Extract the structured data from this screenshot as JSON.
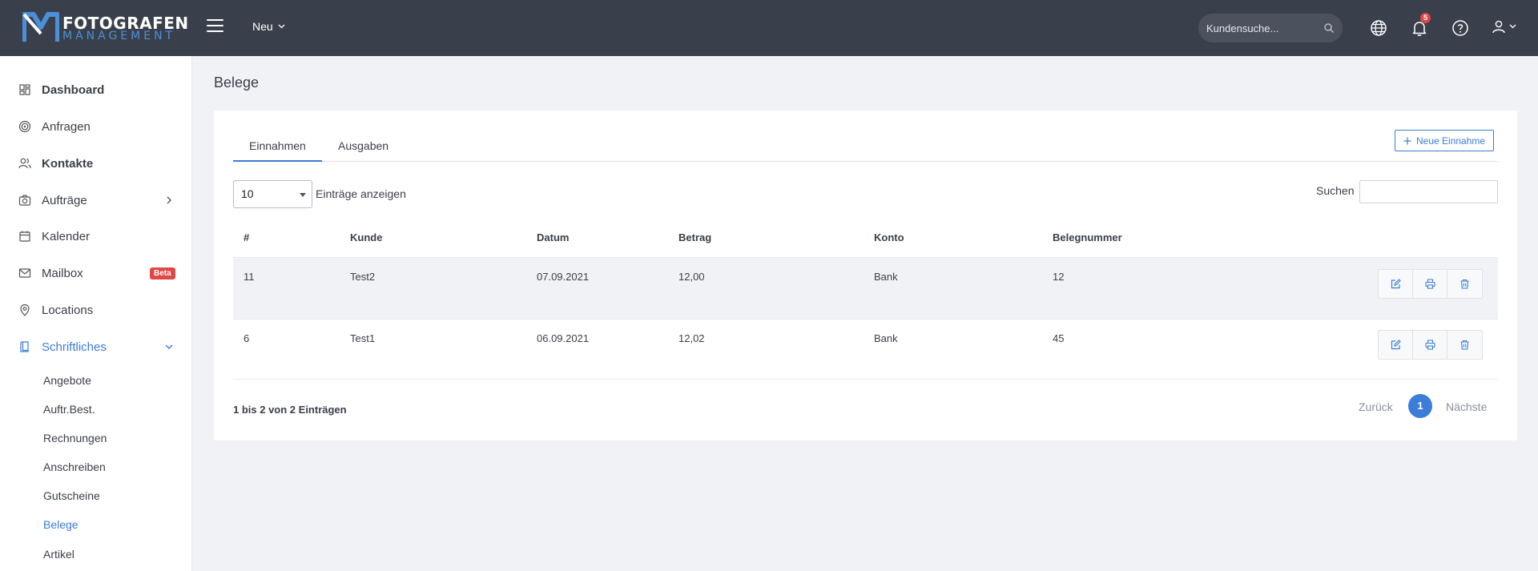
{
  "brand": {
    "line1": "FOTOGRAFEN",
    "line2": "MANAGEMENT"
  },
  "topbar": {
    "new_label": "Neu",
    "search_placeholder": "Kundensuche...",
    "notification_count": "5"
  },
  "sidebar": {
    "items": [
      {
        "label": "Dashboard",
        "icon": "dashboard-icon"
      },
      {
        "label": "Anfragen",
        "icon": "target-icon"
      },
      {
        "label": "Kontakte",
        "icon": "users-icon"
      },
      {
        "label": "Aufträge",
        "icon": "camera-icon"
      },
      {
        "label": "Kalender",
        "icon": "calendar-icon"
      },
      {
        "label": "Mailbox",
        "icon": "mail-icon",
        "badge": "Beta"
      },
      {
        "label": "Locations",
        "icon": "map-pin-icon"
      },
      {
        "label": "Schriftliches",
        "icon": "document-icon"
      }
    ],
    "sub_items": [
      "Angebote",
      "Auftr.Best.",
      "Rechnungen",
      "Anschreiben",
      "Gutscheine",
      "Belege",
      "Artikel"
    ]
  },
  "page": {
    "title": "Belege"
  },
  "tabs": {
    "income": "Einnahmen",
    "expenses": "Ausgaben"
  },
  "new_button": "Neue Einnahme",
  "length": {
    "value": "10",
    "label": "Einträge anzeigen"
  },
  "search": {
    "label": "Suchen"
  },
  "table": {
    "headers": [
      "#",
      "Kunde",
      "Datum",
      "Betrag",
      "Konto",
      "Belegnummer"
    ],
    "rows": [
      [
        "11",
        "Test2",
        "07.09.2021",
        "12,00",
        "Bank",
        "12"
      ],
      [
        "6",
        "Test1",
        "06.09.2021",
        "12,02",
        "Bank",
        "45"
      ]
    ]
  },
  "info": "1 bis 2 von 2 Einträgen",
  "pagination": {
    "prev": "Zurück",
    "current": "1",
    "next": "Nächste"
  },
  "colors": {
    "accent": "#3b7dd8",
    "topbar": "#3a404b",
    "badge": "#e04848"
  }
}
